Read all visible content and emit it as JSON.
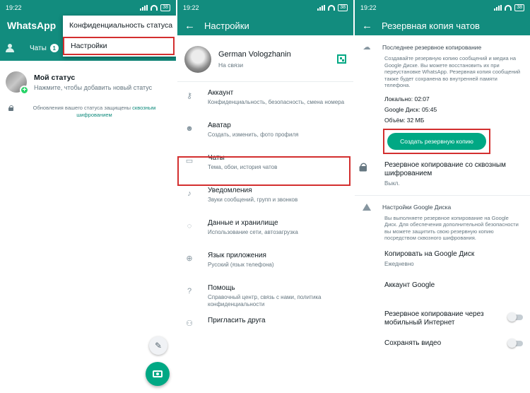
{
  "panel1": {
    "time": "19:22",
    "battery": "38",
    "app_title": "WhatsApp",
    "tab_chats": "Чаты",
    "chats_badge": "1",
    "menu_items": [
      "Конфиденциальность статуса",
      "Настройки"
    ],
    "status_title": "Мой статус",
    "status_sub": "Нажмите, чтобы добавить новый статус",
    "encrypt_text": "Обновления вашего статуса защищены",
    "encrypt_link": "сквозным шифрованием",
    "icons": {
      "pencil": "pencil-icon",
      "camera": "camera-icon",
      "group": "community-icon"
    }
  },
  "panel2": {
    "time": "19:22",
    "battery": "38",
    "title": "Настройки",
    "profile_name": "German Vologzhanin",
    "profile_status": "На связи",
    "items": [
      {
        "title": "Аккаунт",
        "sub": "Конфиденциальность, безопасность, смена номера",
        "icon": "key-icon"
      },
      {
        "title": "Аватар",
        "sub": "Создать, изменить, фото профиля",
        "icon": "avatar-icon"
      },
      {
        "title": "Чаты",
        "sub": "Тема, обои, история чатов",
        "icon": "chat-icon"
      },
      {
        "title": "Уведомления",
        "sub": "Звуки сообщений, групп и звонков",
        "icon": "bell-icon"
      },
      {
        "title": "Данные и хранилище",
        "sub": "Использование сети, автозагрузка",
        "icon": "storage-icon"
      },
      {
        "title": "Язык приложения",
        "sub": "Русский (язык телефона)",
        "icon": "globe-icon"
      },
      {
        "title": "Помощь",
        "sub": "Справочный центр, связь с нами, политика конфиденциальности",
        "icon": "help-icon"
      },
      {
        "title": "Пригласить друга",
        "sub": "",
        "icon": "people-icon"
      }
    ]
  },
  "panel3": {
    "time": "19:22",
    "battery": "38",
    "title": "Резервная копия чатов",
    "last_backup_title": "Последнее резервное копирование",
    "last_backup_desc": "Создавайте резервную копию сообщений и медиа на Google Диске. Вы можете восстановить их при переустановке WhatsApp. Резервная копия сообщений также будет сохранена во внутренней памяти телефона.",
    "local": "Локально: 02:07",
    "gdrive": "Google Диск: 05:45",
    "size": "Объём: 32 МБ",
    "backup_button": "Создать резервную копию",
    "e2e_title": "Резервное копирование со сквозным шифрованием",
    "e2e_sub": "Выкл.",
    "gd_settings_title": "Настройки Google Диска",
    "gd_settings_desc": "Вы выполняете резервное копирование на Google Диск. Для обеспечения дополнительной безопасности вы можете защитить свою резервную копию посредством сквозного шифрования.",
    "copy_to_gd": "Копировать на Google Диск",
    "copy_freq": "Ежедневно",
    "google_account": "Аккаунт Google",
    "mobile_backup": "Резервное копирование через мобильный Интернет",
    "save_video": "Сохранять видео",
    "toggles": {
      "mobile_backup": false,
      "save_video": false
    }
  },
  "colors": {
    "primary": "#128c7e",
    "accent": "#00a884",
    "highlight": "#d32f2f"
  }
}
